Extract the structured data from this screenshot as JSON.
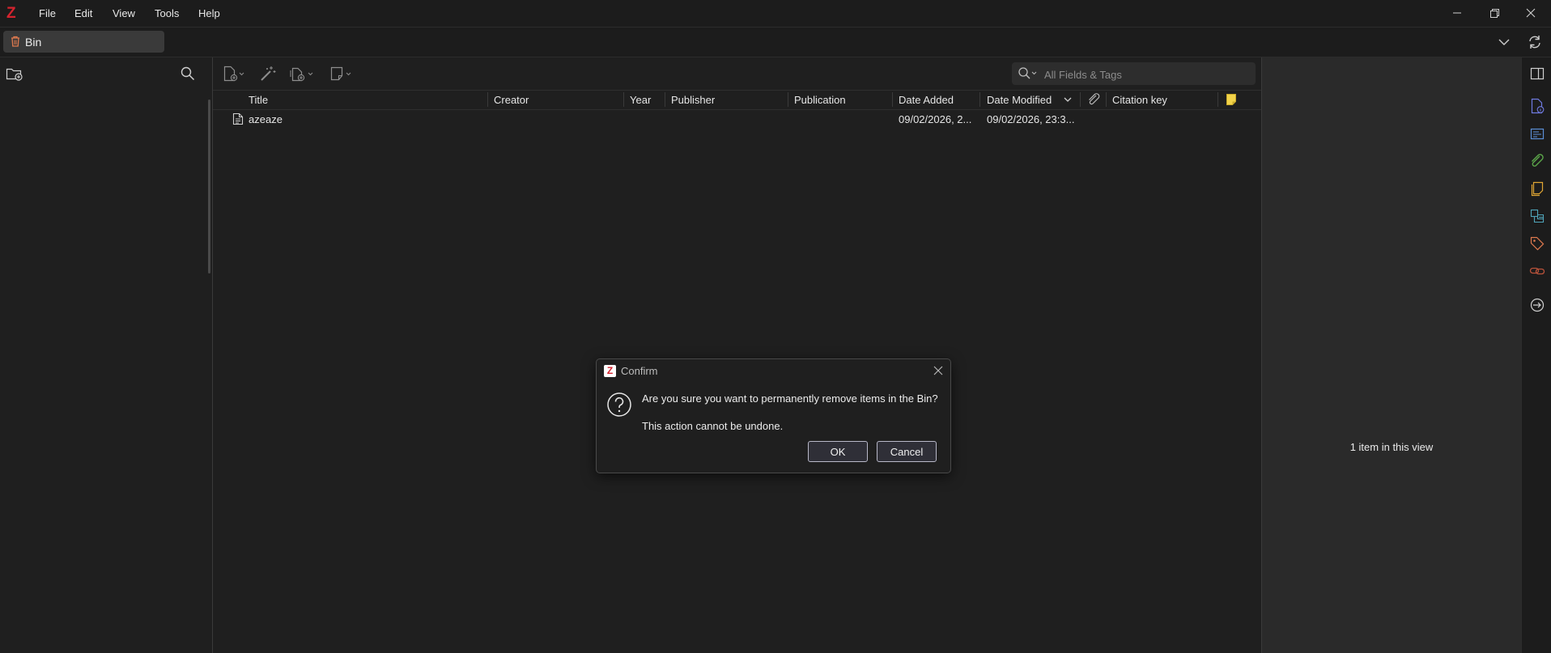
{
  "menu": [
    "File",
    "Edit",
    "View",
    "Tools",
    "Help"
  ],
  "tab": {
    "label": "Bin"
  },
  "search": {
    "placeholder": "All Fields & Tags"
  },
  "columns": {
    "title": "Title",
    "creator": "Creator",
    "year": "Year",
    "publisher": "Publisher",
    "publication": "Publication",
    "date_added": "Date Added",
    "date_modified": "Date Modified",
    "citation_key": "Citation key"
  },
  "items": [
    {
      "title": "azeaze",
      "date_added": "09/02/2026, 2...",
      "date_modified": "09/02/2026, 23:3..."
    }
  ],
  "item_pane": {
    "count_text": "1 item in this view"
  },
  "dialog": {
    "title": "Confirm",
    "message": "Are you sure you want to permanently remove items in the Bin?",
    "detail": "This action cannot be undone.",
    "ok_label": "OK",
    "cancel_label": "Cancel"
  },
  "icons": {
    "app_logo": "zotero-logo",
    "sidenav": [
      "toggle-pane-icon",
      "info-icon",
      "abstract-icon",
      "attachments-icon",
      "notes-icon",
      "libraries-collections-icon",
      "tags-icon",
      "related-icon",
      "locate-icon"
    ]
  },
  "colors": {
    "brand": "#d4232e",
    "background": "#1f1f1f",
    "item_pane": "#2a2a2a"
  }
}
